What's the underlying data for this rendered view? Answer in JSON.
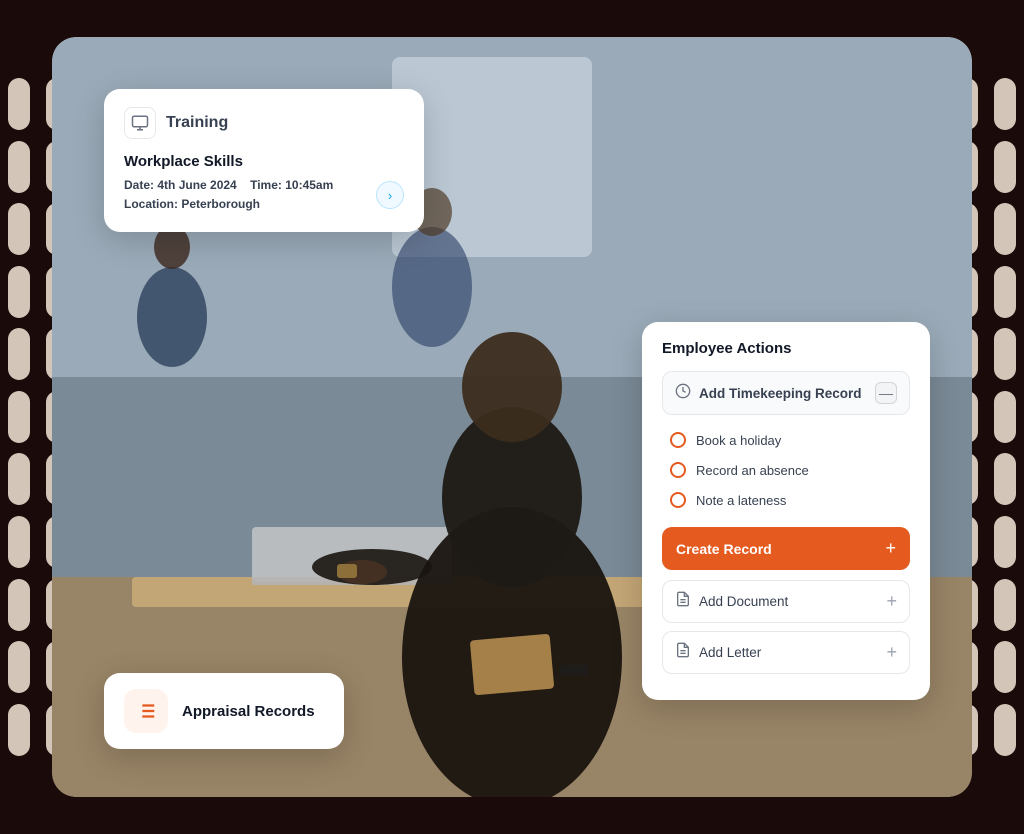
{
  "scene": {
    "bg_color": "#2d1a0a"
  },
  "training_card": {
    "icon": "🖥",
    "header_label": "Training",
    "course_name": "Workplace Skills",
    "date_label": "Date:",
    "date_value": "4th June 2024",
    "time_label": "Time:",
    "time_value": "10:45am",
    "location_label": "Location:",
    "location_value": "Peterborough",
    "chevron": "›"
  },
  "employee_actions": {
    "title": "Employee Actions",
    "timekeeping": {
      "label": "Add Timekeeping Record",
      "icon": "⏱",
      "minus": "—"
    },
    "sub_items": [
      {
        "label": "Book a holiday"
      },
      {
        "label": "Record an absence"
      },
      {
        "label": "Note a lateness"
      }
    ],
    "create_record": {
      "label": "Create Record",
      "plus": "+"
    },
    "secondary_items": [
      {
        "label": "Add Document",
        "icon": "📄"
      },
      {
        "label": "Add Letter",
        "icon": "📄"
      }
    ]
  },
  "appraisal_card": {
    "icon": "≡",
    "label": "Appraisal Records"
  },
  "decorative_pills": {
    "count": 11,
    "color": "#f5e8d8"
  }
}
